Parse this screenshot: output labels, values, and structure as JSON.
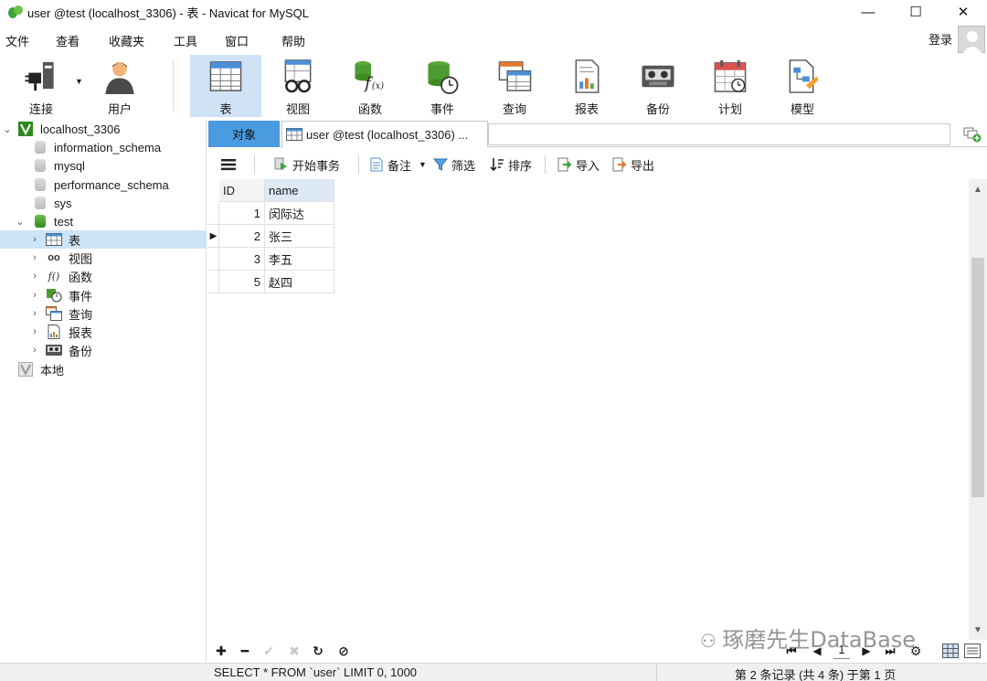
{
  "window": {
    "title": "user @test (localhost_3306) - 表 - Navicat for MySQL",
    "minimize": "—",
    "maximize": "☐",
    "close": "✕"
  },
  "menu": [
    "文件",
    "查看",
    "收藏夹",
    "工具",
    "窗口",
    "帮助"
  ],
  "account": {
    "login_label": "登录"
  },
  "toolbar": {
    "items": [
      {
        "label": "连接",
        "icon": "connection-plug-icon"
      },
      {
        "label": "用户",
        "icon": "user-icon"
      },
      {
        "label": "表",
        "icon": "table-icon"
      },
      {
        "label": "视图",
        "icon": "view-glasses-icon"
      },
      {
        "label": "函数",
        "icon": "function-fx-icon"
      },
      {
        "label": "事件",
        "icon": "event-clock-icon"
      },
      {
        "label": "查询",
        "icon": "query-table-icon"
      },
      {
        "label": "报表",
        "icon": "report-chart-icon"
      },
      {
        "label": "备份",
        "icon": "backup-tape-icon"
      },
      {
        "label": "计划",
        "icon": "schedule-calendar-icon"
      },
      {
        "label": "模型",
        "icon": "model-diagram-icon"
      }
    ]
  },
  "tree": {
    "connection": "localhost_3306",
    "databases": [
      "information_schema",
      "mysql",
      "performance_schema",
      "sys"
    ],
    "open_db": "test",
    "children": [
      "表",
      "视图",
      "函数",
      "事件",
      "查询",
      "报表",
      "备份"
    ],
    "local": "本地"
  },
  "tabs": {
    "objects": "对象",
    "document": "user @test (localhost_3306) ..."
  },
  "actions": {
    "begin_transaction": "开始事务",
    "memo": "备注",
    "filter": "筛选",
    "sort": "排序",
    "import": "导入",
    "export": "导出"
  },
  "table": {
    "columns": [
      "ID",
      "name"
    ],
    "rows": [
      {
        "id": "1",
        "name": "闵际达"
      },
      {
        "id": "2",
        "name": "张三"
      },
      {
        "id": "3",
        "name": "李五"
      },
      {
        "id": "5",
        "name": "赵四"
      }
    ],
    "selected_row_index": 1
  },
  "pager": {
    "current_page": "1"
  },
  "watermark": "琢磨先生DataBase",
  "status": {
    "sql": "SELECT * FROM `user` LIMIT 0, 1000",
    "record_info": "第 2 条记录 (共 4 条) 于第 1 页"
  },
  "colors": {
    "active_tool_bg": "#cfe3f5",
    "objects_tab_bg": "#4a9be0",
    "tree_selection": "#cce4f7",
    "db_green": "#2f8a1e"
  }
}
